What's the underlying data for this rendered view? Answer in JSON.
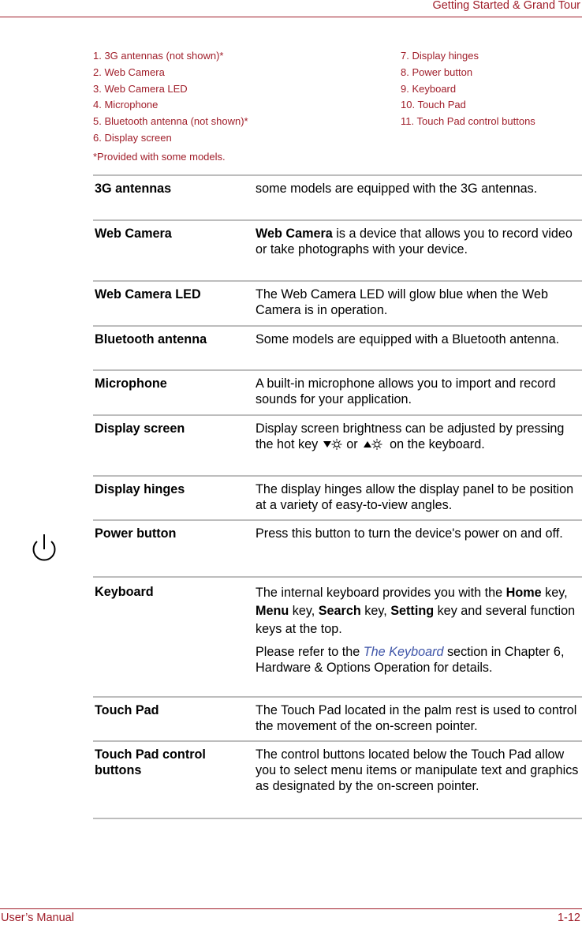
{
  "header": {
    "title": "Getting Started & Grand Tour"
  },
  "legend": {
    "left": [
      "1. 3G antennas (not shown)*",
      "2. Web Camera",
      "3. Web Camera LED",
      "4. Microphone",
      "5. Bluetooth antenna (not shown)*",
      "6. Display screen"
    ],
    "right": [
      "7. Display hinges",
      "8. Power button",
      "9. Keyboard",
      "10. Touch Pad",
      "11. Touch Pad control buttons"
    ],
    "footnote": "*Provided with some models."
  },
  "table": {
    "rows": [
      {
        "term": "3G antennas",
        "desc": "some models are equipped with the 3G antennas."
      },
      {
        "term": "Web Camera",
        "desc_bold": "Web Camera",
        "desc": " is a device that allows you to record video or take photographs with your device."
      },
      {
        "term": "Web Camera LED",
        "desc": "The Web Camera LED will glow blue when the Web Camera is in operation."
      },
      {
        "term": "Bluetooth antenna",
        "desc": "Some models are equipped with a Bluetooth antenna."
      },
      {
        "term": "Microphone",
        "desc": "A built-in microphone allows you to import and record sounds for your application."
      },
      {
        "term": "Display screen",
        "desc_a": "Display screen brightness can be adjusted by pressing the hot key",
        "desc_or": "or",
        "desc_b": "on the keyboard.",
        "icon_down": "brightness-down-icon",
        "icon_up": "brightness-up-icon"
      },
      {
        "term": "Display hinges",
        "desc": "The display hinges allow the display panel to be position at a variety of easy-to-view angles."
      },
      {
        "term": "Power button",
        "desc": "Press this button to turn the device's power on and off.",
        "icon": "power-icon"
      },
      {
        "term": "Keyboard",
        "p1_a": "The internal keyboard provides you with the ",
        "k1": "Home",
        "t1": " key, ",
        "k2": "Menu",
        "t2": " key, ",
        "k3": "Search",
        "t3": " key, ",
        "k4": "Setting",
        "t4": " key and several function keys at the top.",
        "p2_a": "Please refer to the ",
        "p2_link": "The Keyboard",
        "p2_b": " section in Chapter 6, Hardware & Options Operation for details."
      },
      {
        "term": "Touch Pad",
        "desc": "The Touch Pad located in the palm rest is used to control the movement of the on-screen pointer."
      },
      {
        "term": "Touch Pad control buttons",
        "desc": "The control buttons located below the Touch Pad allow you to select menu items or manipulate text and graphics as designated by the on-screen pointer."
      }
    ]
  },
  "footer": {
    "left": "User’s Manual",
    "right": "1-12"
  },
  "colors": {
    "accent": "#a01e2a",
    "link": "#3f55a8",
    "rule": "#bdbdbd"
  }
}
